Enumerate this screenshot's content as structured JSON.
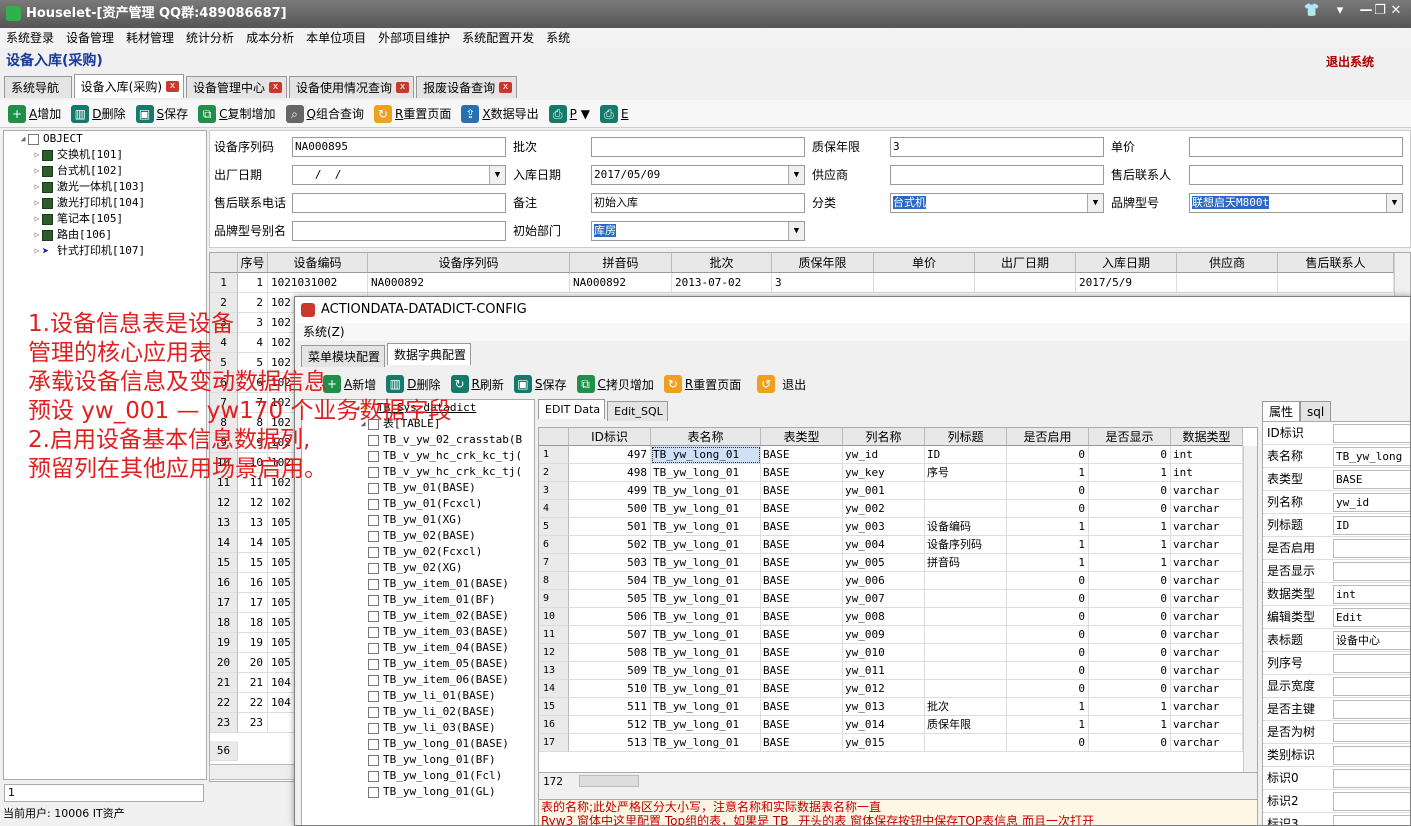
{
  "window": {
    "title": "Houselet-[资产管理 QQ群:489086687]",
    "buttons": [
      "👕",
      "▾",
      "—",
      "❐",
      "✕"
    ]
  },
  "menu": [
    "系统登录",
    "设备管理",
    "耗材管理",
    "统计分析",
    "成本分析",
    "本单位项目",
    "外部项目维护",
    "系统配置开发",
    "系统"
  ],
  "page": {
    "title": "设备入库(采购)",
    "exit": "退出系统"
  },
  "tabs": [
    {
      "label": "系统导航"
    },
    {
      "label": "设备入库(采购)"
    },
    {
      "label": "设备管理中心"
    },
    {
      "label": "设备使用情况查询"
    },
    {
      "label": "报废设备查询"
    }
  ],
  "tab_close": "x",
  "toolbar": [
    {
      "key": "A",
      "label": "增加",
      "icon": "add-icon"
    },
    {
      "key": "D",
      "label": "删除",
      "icon": "trash-icon"
    },
    {
      "key": "S",
      "label": "保存",
      "icon": "save-icon"
    },
    {
      "key": "C",
      "label": "复制增加",
      "icon": "copy-add-icon"
    },
    {
      "key": "Q",
      "label": "组合查询",
      "icon": "query-icon"
    },
    {
      "key": "R",
      "label": "重置页面",
      "icon": "refresh-icon"
    },
    {
      "key": "X",
      "label": "数据导出",
      "icon": "export-icon"
    },
    {
      "key": "P",
      "label": "▼",
      "icon": "print-icon"
    },
    {
      "key": "E",
      "label": "",
      "icon": "print2-icon"
    }
  ],
  "tree": {
    "root": "OBJECT",
    "items": [
      "交换机[101]",
      "台式机[102]",
      "激光一体机[103]",
      "激光打印机[104]",
      "笔记本[105]",
      "路由[106]",
      "针式打印机[107]"
    ]
  },
  "form": {
    "labels": {
      "serial": "设备序列码",
      "batch": "批次",
      "warranty": "质保年限",
      "price": "单价",
      "mfg_date": "出厂日期",
      "in_date": "入库日期",
      "supplier": "供应商",
      "contact": "售后联系人",
      "phone": "售后联系电话",
      "note": "备注",
      "category": "分类",
      "brand": "品牌型号",
      "alias": "品牌型号别名",
      "dept": "初始部门"
    },
    "values": {
      "serial": "NA000895",
      "batch": "",
      "warranty": "3",
      "price": "",
      "mfg_date": "   /  /",
      "in_date": "2017/05/09",
      "supplier": "",
      "contact": "",
      "phone": "",
      "note": "初始入库",
      "category": "台式机",
      "brand": "联想启天M800t",
      "alias": "",
      "dept": "库房"
    }
  },
  "grid1": {
    "headers": [
      "序号",
      "设备编码",
      "设备序列码",
      "拼音码",
      "批次",
      "质保年限",
      "单价",
      "出厂日期",
      "入库日期",
      "供应商",
      "售后联系人"
    ],
    "row1": [
      "1",
      "1021031002",
      "NA000892",
      "NA000892",
      "2013-07-02",
      "3",
      "",
      "",
      "2017/5/9",
      "",
      ""
    ],
    "row_nums": [
      "2",
      "3",
      "4",
      "5",
      "6",
      "7",
      "8",
      "9",
      "10",
      "11",
      "12",
      "13",
      "14",
      "15",
      "16",
      "17",
      "18",
      "19",
      "20",
      "21",
      "22",
      "23"
    ],
    "seq": [
      "2",
      "3",
      "4",
      "5",
      "6",
      "7",
      "8",
      "9",
      "10",
      "11",
      "12",
      "13",
      "14",
      "15",
      "16",
      "17",
      "18",
      "19",
      "20",
      "21",
      "22",
      "23"
    ],
    "code_prefix": [
      "102",
      "102",
      "102",
      "102",
      "102",
      "102",
      "102",
      "102",
      "102",
      "102",
      "102",
      "105",
      "105",
      "105",
      "105",
      "105",
      "105",
      "105",
      "105",
      "104",
      "104",
      ""
    ],
    "footer_count": "56",
    "bottom_num": "1"
  },
  "annotation": [
    "1.设备信息表是设备",
    "管理的核心应用表",
    "承载设备信息及变动数据信息",
    "预设 yw_001 — yw170 个业务数据字段",
    "2.启用设备基本信息数据列,",
    "预留列在其他应用场景启用。"
  ],
  "status": {
    "user_label": "当前用户:",
    "user": "10006 IT资产"
  },
  "dialog": {
    "title": "ACTIONDATA-DATADICT-CONFIG",
    "menu": "系统(Z)",
    "tabs": [
      "菜单模块配置",
      "数据字典配置"
    ],
    "toolbar": [
      {
        "key": "A",
        "label": "新增"
      },
      {
        "key": "D",
        "label": "删除"
      },
      {
        "key": "R",
        "label": "刷新"
      },
      {
        "key": "S",
        "label": "保存"
      },
      {
        "key": "C",
        "label": "拷贝增加"
      },
      {
        "key": "R",
        "label": "重置页面"
      },
      {
        "key": "",
        "label": "退出"
      }
    ],
    "tree": {
      "root": "TB_Sys_datadict",
      "table": "表[TABLE]",
      "items": [
        "TB_v_yw_02_crasstab(B",
        "TB_v_yw_hc_crk_kc_tj(",
        "TB_v_yw_hc_crk_kc_tj(",
        "TB_yw_01(BASE)",
        "TB_yw_01(Fcxcl)",
        "TB_yw_01(XG)",
        "TB_yw_02(BASE)",
        "TB_yw_02(Fcxcl)",
        "TB_yw_02(XG)",
        "TB_yw_item_01(BASE)",
        "TB_yw_item_01(BF)",
        "TB_yw_item_02(BASE)",
        "TB_yw_item_03(BASE)",
        "TB_yw_item_04(BASE)",
        "TB_yw_item_05(BASE)",
        "TB_yw_item_06(BASE)",
        "TB_yw_li_01(BASE)",
        "TB_yw_li_02(BASE)",
        "TB_yw_li_03(BASE)",
        "TB_yw_long_01(BASE)",
        "TB_yw_long_01(BF)",
        "TB_yw_long_01(Fcl)",
        "TB_yw_long_01(GL)"
      ]
    },
    "edit_tabs": [
      "EDIT Data",
      "Edit_SQL"
    ],
    "grid_headers": [
      "ID标识",
      "表名称",
      "表类型",
      "列名称",
      "列标题",
      "是否启用",
      "是否显示",
      "数据类型"
    ],
    "rows": [
      [
        "1",
        "497",
        "TB_yw_long_01",
        "BASE",
        "yw_id",
        "ID",
        "0",
        "0",
        "int"
      ],
      [
        "2",
        "498",
        "TB_yw_long_01",
        "BASE",
        "yw_key",
        "序号",
        "1",
        "1",
        "int"
      ],
      [
        "3",
        "499",
        "TB_yw_long_01",
        "BASE",
        "yw_001",
        "",
        "0",
        "0",
        "varchar"
      ],
      [
        "4",
        "500",
        "TB_yw_long_01",
        "BASE",
        "yw_002",
        "",
        "0",
        "0",
        "varchar"
      ],
      [
        "5",
        "501",
        "TB_yw_long_01",
        "BASE",
        "yw_003",
        "设备编码",
        "1",
        "1",
        "varchar"
      ],
      [
        "6",
        "502",
        "TB_yw_long_01",
        "BASE",
        "yw_004",
        "设备序列码",
        "1",
        "1",
        "varchar"
      ],
      [
        "7",
        "503",
        "TB_yw_long_01",
        "BASE",
        "yw_005",
        "拼音码",
        "1",
        "1",
        "varchar"
      ],
      [
        "8",
        "504",
        "TB_yw_long_01",
        "BASE",
        "yw_006",
        "",
        "0",
        "0",
        "varchar"
      ],
      [
        "9",
        "505",
        "TB_yw_long_01",
        "BASE",
        "yw_007",
        "",
        "0",
        "0",
        "varchar"
      ],
      [
        "10",
        "506",
        "TB_yw_long_01",
        "BASE",
        "yw_008",
        "",
        "0",
        "0",
        "varchar"
      ],
      [
        "11",
        "507",
        "TB_yw_long_01",
        "BASE",
        "yw_009",
        "",
        "0",
        "0",
        "varchar"
      ],
      [
        "12",
        "508",
        "TB_yw_long_01",
        "BASE",
        "yw_010",
        "",
        "0",
        "0",
        "varchar"
      ],
      [
        "13",
        "509",
        "TB_yw_long_01",
        "BASE",
        "yw_011",
        "",
        "0",
        "0",
        "varchar"
      ],
      [
        "14",
        "510",
        "TB_yw_long_01",
        "BASE",
        "yw_012",
        "",
        "0",
        "0",
        "varchar"
      ],
      [
        "15",
        "511",
        "TB_yw_long_01",
        "BASE",
        "yw_013",
        "批次",
        "1",
        "1",
        "varchar"
      ],
      [
        "16",
        "512",
        "TB_yw_long_01",
        "BASE",
        "yw_014",
        "质保年限",
        "1",
        "1",
        "varchar"
      ],
      [
        "17",
        "513",
        "TB_yw_long_01",
        "BASE",
        "yw_015",
        "",
        "0",
        "0",
        "varchar"
      ]
    ],
    "row_count": "172",
    "desc": [
      "表的名称;此处严格区分大小写，注意名称和实际数据表名称一直",
      "Ryw3 窗体中这里配置 Top组的表，如果是 TB_ 开头的表 窗体保存按钮中保存TOP表信息 而且一次打开"
    ],
    "prop_tabs": [
      "属性",
      "sql"
    ],
    "props": [
      {
        "label": "ID标识",
        "value": ""
      },
      {
        "label": "表名称",
        "value": "TB_yw_long"
      },
      {
        "label": "表类型",
        "value": "BASE"
      },
      {
        "label": "列名称",
        "value": "yw_id"
      },
      {
        "label": "列标题",
        "value": "ID"
      },
      {
        "label": "是否启用",
        "value": ""
      },
      {
        "label": "是否显示",
        "value": ""
      },
      {
        "label": "数据类型",
        "value": "int"
      },
      {
        "label": "编辑类型",
        "value": "Edit"
      },
      {
        "label": "表标题",
        "value": "设备中心"
      },
      {
        "label": "列序号",
        "value": ""
      },
      {
        "label": "显示宽度",
        "value": ""
      },
      {
        "label": "是否主键",
        "value": ""
      },
      {
        "label": "是否为树",
        "value": ""
      },
      {
        "label": "类别标识",
        "value": ""
      },
      {
        "label": "标识0",
        "value": ""
      },
      {
        "label": "标识2",
        "value": ""
      },
      {
        "label": "标识3",
        "value": ""
      }
    ]
  }
}
